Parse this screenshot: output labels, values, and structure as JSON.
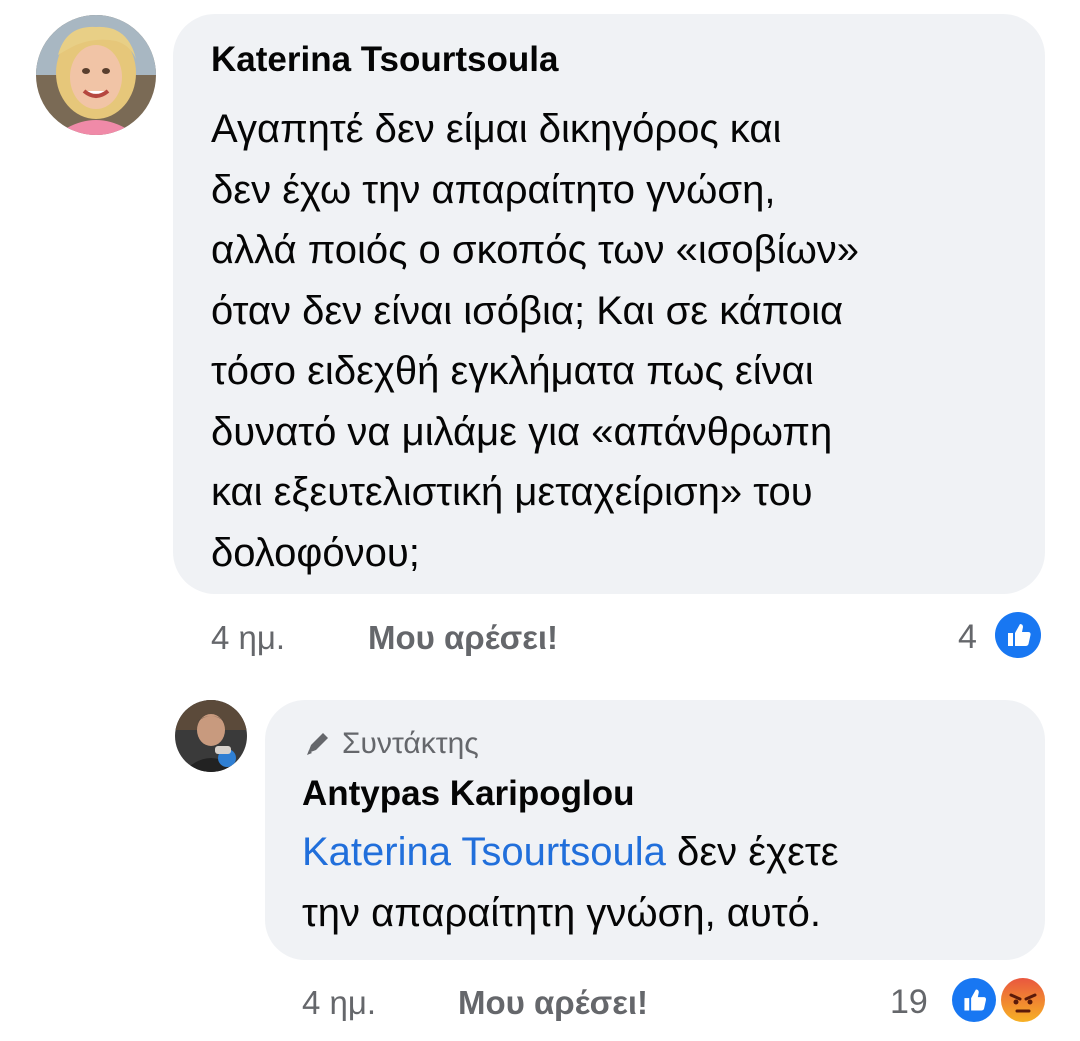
{
  "comment": {
    "author": "Katerina Tsourtsoula",
    "lines": [
      "Αγαπητέ δεν είμαι δικηγόρος και",
      "δεν έχω την απαραίτητο γνώση,",
      "αλλά ποιός ο σκοπός των «ισοβίων»",
      "όταν δεν είναι ισόβια; Και σε κάποια",
      "τόσο ειδεχθή εγκλήματα πως είναι",
      "δυνατό να μιλάμε για «απάνθρωπη",
      "και εξευτελιστική μεταχείριση» του",
      "δολοφόνου;"
    ],
    "time": "4 ημ.",
    "like_label": "Μου αρέσει!",
    "reaction_count": "4",
    "reactions": [
      "like-icon"
    ]
  },
  "reply": {
    "role": "Συντάκτης",
    "role_icon": "pen-icon",
    "author": "Antypas Karipoglou",
    "mention": "Katerina Tsourtsoula",
    "line1_rest": " δεν έχετε",
    "line2": "την απαραίτητη γνώση, αυτό.",
    "time": "4 ημ.",
    "like_label": "Μου αρέσει!",
    "reaction_count": "19",
    "reactions": [
      "like-icon",
      "angry-icon"
    ]
  },
  "colors": {
    "bubble": "#f0f2f5",
    "meta": "#65676b",
    "mention": "#216fdb",
    "like": "#1877f2"
  }
}
